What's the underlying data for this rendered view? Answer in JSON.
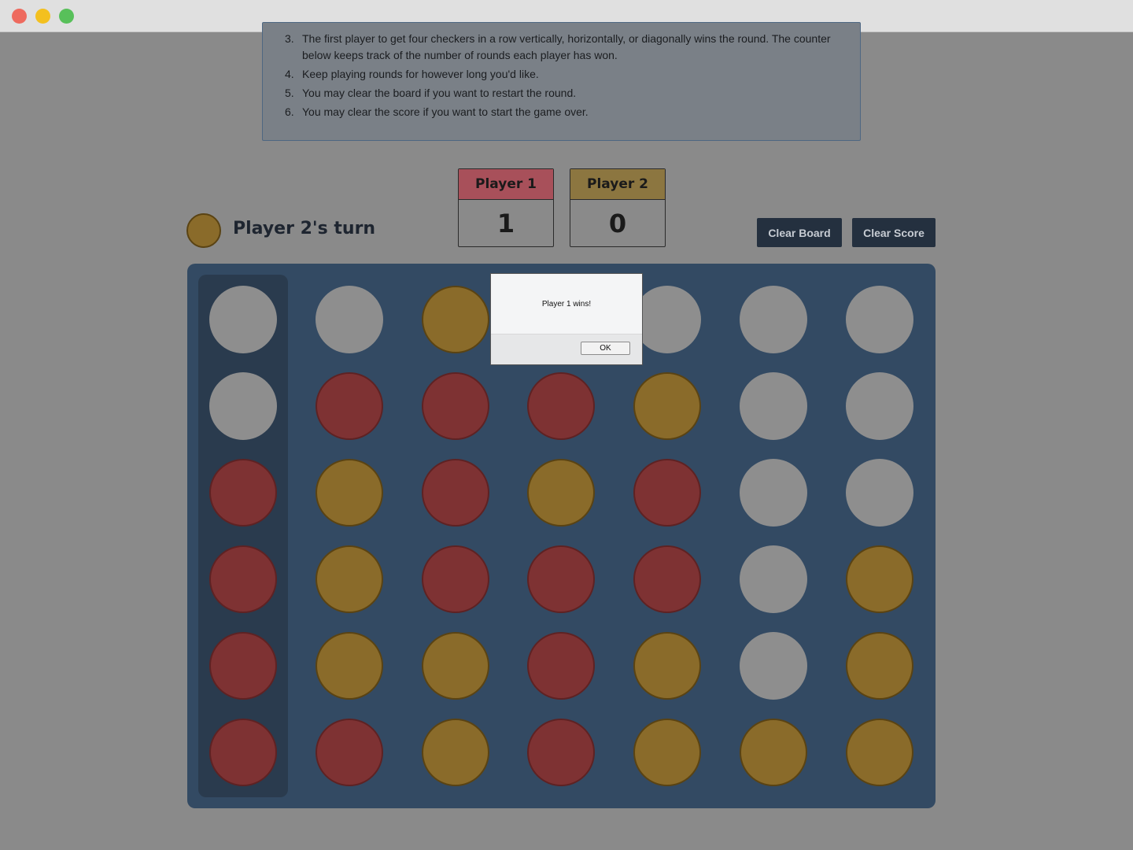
{
  "window": {
    "traffic_lights": [
      "close",
      "minimize",
      "zoom"
    ]
  },
  "instructions": {
    "items": [
      {
        "num": "3.",
        "text": "The first player to get four checkers in a row vertically, horizontally, or diagonally wins the round. The counter below keeps track of the number of rounds each player has won."
      },
      {
        "num": "4.",
        "text": "Keep playing rounds for however long you'd like."
      },
      {
        "num": "5.",
        "text": "You may clear the board if you want to restart the round."
      },
      {
        "num": "6.",
        "text": "You may clear the score if you want to start the game over."
      }
    ]
  },
  "scoreboard": {
    "player1": {
      "label": "Player 1",
      "score": "1",
      "color": "#a8505a"
    },
    "player2": {
      "label": "Player 2",
      "score": "0",
      "color": "#8c7640"
    }
  },
  "turn": {
    "label": "Player 2's turn",
    "player": 2
  },
  "buttons": {
    "clear_board": "Clear Board",
    "clear_score": "Clear Score"
  },
  "board": {
    "rows": 6,
    "cols": 7,
    "highlighted_column": 0,
    "cells": [
      [
        0,
        0,
        2,
        0,
        0,
        0,
        0
      ],
      [
        0,
        1,
        1,
        1,
        2,
        0,
        0
      ],
      [
        1,
        2,
        1,
        2,
        1,
        0,
        0
      ],
      [
        1,
        2,
        1,
        1,
        1,
        0,
        2
      ],
      [
        1,
        2,
        2,
        1,
        2,
        0,
        2
      ],
      [
        1,
        1,
        2,
        1,
        2,
        2,
        2
      ]
    ],
    "colors": {
      "empty": "#8e8e8e",
      "player1": "#7e3233",
      "player2": "#8a6b2a",
      "board": "#334a63"
    }
  },
  "dialog": {
    "message": "Player 1 wins!",
    "ok_label": "OK"
  }
}
